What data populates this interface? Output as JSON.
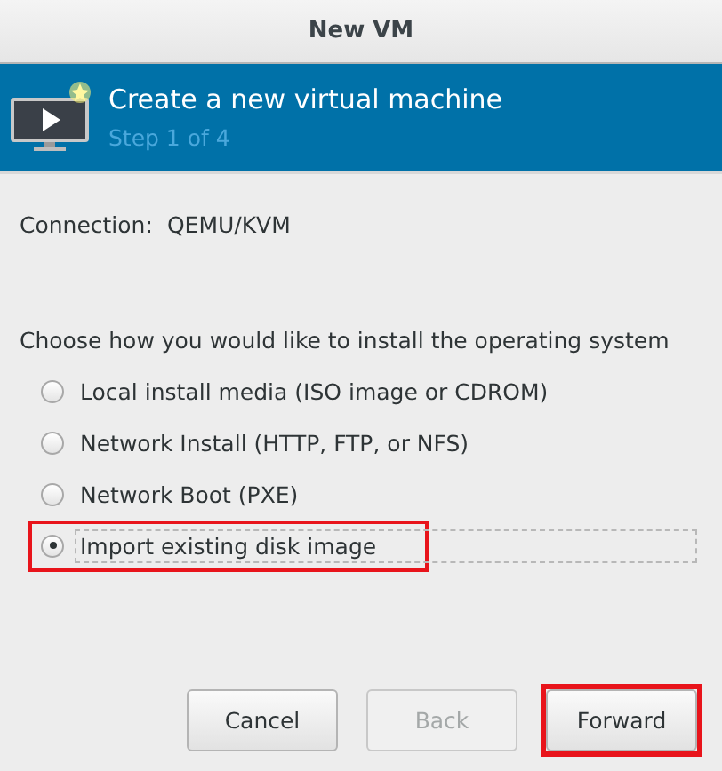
{
  "window": {
    "title": "New VM"
  },
  "header": {
    "title": "Create a new virtual machine",
    "subtitle": "Step 1 of 4"
  },
  "connection": {
    "label": "Connection:",
    "value": "QEMU/KVM"
  },
  "prompt": "Choose how you would like to install the operating system",
  "options": [
    {
      "label": "Local install media (ISO image or CDROM)",
      "selected": false,
      "annotated": false
    },
    {
      "label": "Network Install (HTTP, FTP, or NFS)",
      "selected": false,
      "annotated": false
    },
    {
      "label": "Network Boot (PXE)",
      "selected": false,
      "annotated": false
    },
    {
      "label": "Import existing disk image",
      "selected": true,
      "annotated": true
    }
  ],
  "buttons": [
    {
      "label": "Cancel",
      "disabled": false,
      "annotated": false
    },
    {
      "label": "Back",
      "disabled": true,
      "annotated": false
    },
    {
      "label": "Forward",
      "disabled": false,
      "annotated": true
    }
  ]
}
